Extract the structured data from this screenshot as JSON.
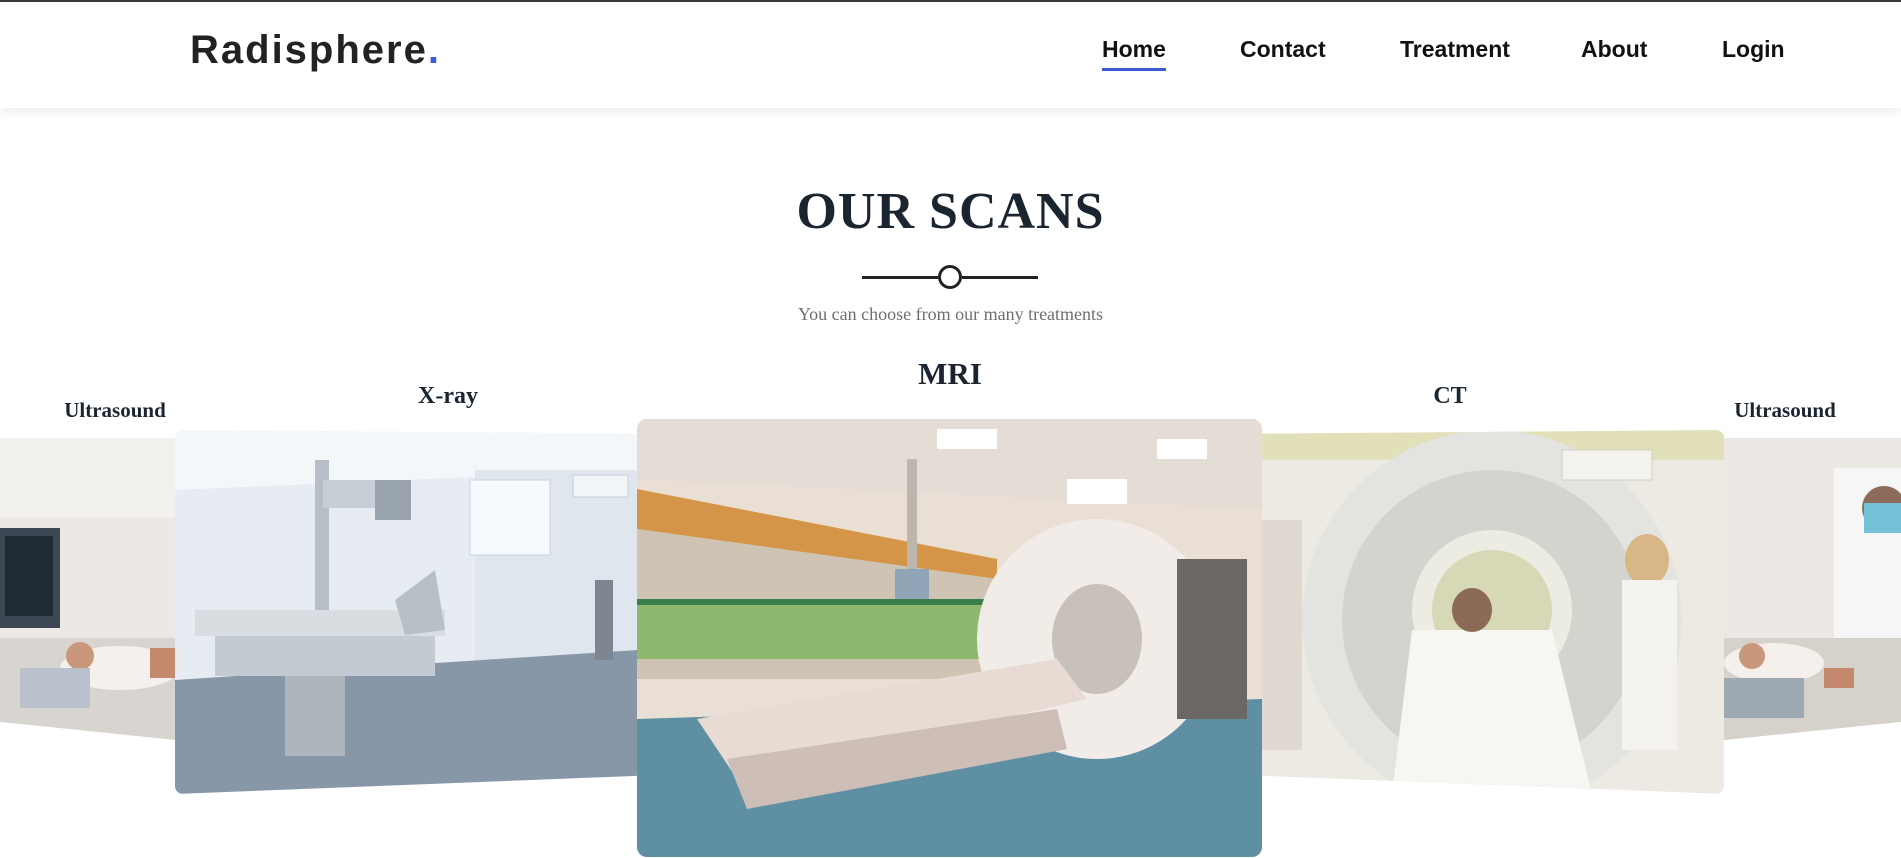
{
  "brand": {
    "name": "Radisphere",
    "dot": ".",
    "accent_color": "#3d5bd1"
  },
  "nav": {
    "items": [
      {
        "label": "Home",
        "active": true
      },
      {
        "label": "Contact",
        "active": false
      },
      {
        "label": "Treatment",
        "active": false
      },
      {
        "label": "About",
        "active": false
      },
      {
        "label": "Login",
        "active": false
      }
    ]
  },
  "section": {
    "title": "OUR SCANS",
    "subtitle": "You can choose from our many treatments"
  },
  "carousel": {
    "cards": [
      {
        "label": "Ultrasound",
        "image": "ultrasound-exam-photo"
      },
      {
        "label": "X-ray",
        "image": "xray-room-photo"
      },
      {
        "label": "MRI",
        "image": "mri-scanner-photo"
      },
      {
        "label": "CT",
        "image": "ct-scanner-photo"
      },
      {
        "label": "Ultrasound",
        "image": "ultrasound-exam-photo"
      }
    ],
    "active_index": 2
  }
}
